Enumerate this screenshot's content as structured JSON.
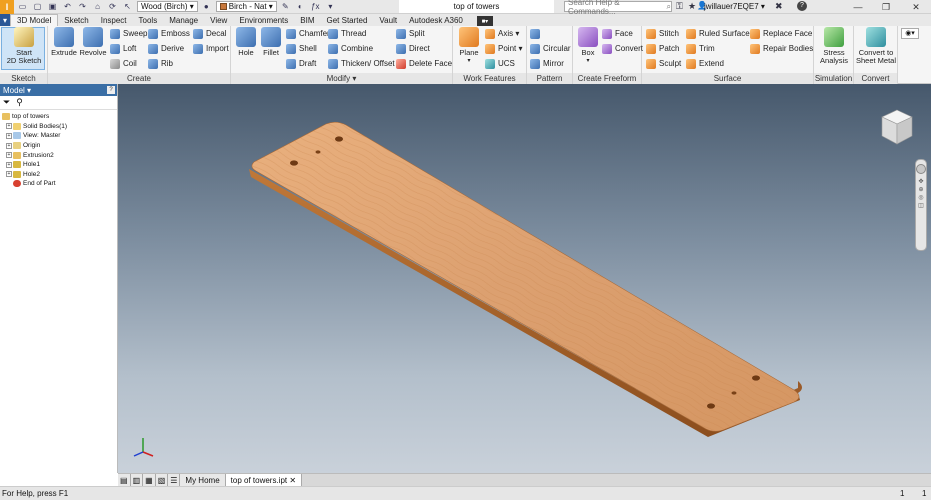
{
  "app": {
    "logo_text": "I"
  },
  "qat": {
    "material": "Wood (Birch)",
    "appearance": "Birch - Nat",
    "icons": [
      "new-icon",
      "open-icon",
      "save-icon",
      "undo-icon",
      "redo-icon",
      "home-icon",
      "update-icon",
      "select-icon",
      "material-icon",
      "appearance-icon",
      "clear-icon",
      "adjust-icon",
      "parameters-icon",
      "measure-icon"
    ]
  },
  "titlebar": {
    "doc_title": "top of towers",
    "search_placeholder": "Search Help & Commands...",
    "user": "jwillauer7EQE7",
    "help_label": "?"
  },
  "tabs": [
    "3D Model",
    "Sketch",
    "Inspect",
    "Tools",
    "Manage",
    "View",
    "Environments",
    "BIM",
    "Get Started",
    "Vault",
    "Autodesk A360"
  ],
  "active_tab": "3D Model",
  "ribbon": {
    "sketch": {
      "title": "Sketch",
      "start_sketch": "Start\n2D Sketch"
    },
    "create": {
      "title": "Create",
      "extrude": "Extrude",
      "revolve": "Revolve",
      "sweep": "Sweep",
      "loft": "Loft",
      "coil": "Coil",
      "emboss": "Emboss",
      "derive": "Derive",
      "rib": "Rib",
      "decal": "Decal",
      "import": "Import"
    },
    "modify": {
      "title": "Modify",
      "hole": "Hole",
      "fillet": "Fillet",
      "chamfer": "Chamfer",
      "shell": "Shell",
      "draft": "Draft",
      "thread": "Thread",
      "combine": "Combine",
      "thicken": "Thicken/ Offset",
      "split": "Split",
      "direct": "Direct",
      "delete_face": "Delete Face"
    },
    "work_features": {
      "title": "Work Features",
      "plane": "Plane",
      "axis": "Axis",
      "point": "Point",
      "ucs": "UCS"
    },
    "pattern": {
      "title": "Pattern",
      "circular": "Circular",
      "mirror": "Mirror"
    },
    "freeform": {
      "title": "Create Freeform",
      "box": "Box",
      "face": "Face",
      "convert": "Convert"
    },
    "surface": {
      "title": "Surface",
      "stitch": "Stitch",
      "patch": "Patch",
      "sculpt": "Sculpt",
      "ruled_surface": "Ruled Surface",
      "trim": "Trim",
      "extend": "Extend",
      "replace_face": "Replace Face",
      "repair_bodies": "Repair Bodies"
    },
    "simulation": {
      "title": "Simulation",
      "stress": "Stress\nAnalysis"
    },
    "convert": {
      "title": "Convert",
      "sheet_metal": "Convert to\nSheet Metal"
    }
  },
  "browser": {
    "title": "Model",
    "help": "?",
    "tree": [
      {
        "label": "top of towers",
        "indent": 0
      },
      {
        "label": "Solid Bodies(1)",
        "indent": 1
      },
      {
        "label": "View: Master",
        "indent": 1
      },
      {
        "label": "Origin",
        "indent": 1
      },
      {
        "label": "Extrusion2",
        "indent": 1
      },
      {
        "label": "Hole1",
        "indent": 1
      },
      {
        "label": "Hole2",
        "indent": 1
      },
      {
        "label": "End of Part",
        "indent": 1
      }
    ]
  },
  "doc_tabs": [
    "My Home",
    "top of towers.ipt"
  ],
  "status": {
    "left": "For Help, press F1",
    "right1": "1",
    "right2": "1"
  },
  "colors": {
    "wood_light": "#dca070",
    "wood_dark": "#a8622e",
    "browser_header": "#3a6ea5",
    "sketch_button_bg": "#cfe4f7"
  }
}
